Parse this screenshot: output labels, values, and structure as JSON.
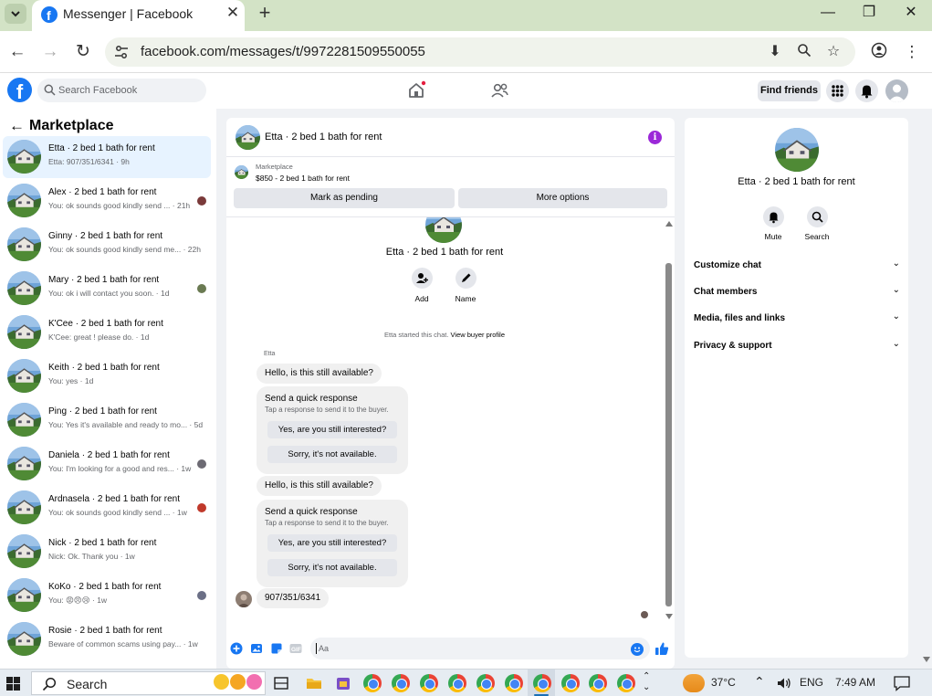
{
  "browser": {
    "tab_title": "Messenger | Facebook",
    "url": "facebook.com/messages/t/9972281509550055"
  },
  "fb": {
    "search_placeholder": "Search Facebook",
    "find_friends": "Find friends",
    "brand_color": "#1877f2"
  },
  "marketplace": {
    "title": "Marketplace",
    "conversations": [
      {
        "name": "Etta · 2 bed 1 bath for rent",
        "snippet": "Etta: 907/351/6341 · 9h",
        "active": true
      },
      {
        "name": "Alex · 2 bed 1 bath for rent",
        "snippet": "You: ok sounds good kindly send ... · 21h"
      },
      {
        "name": "Ginny · 2 bed 1 bath for rent",
        "snippet": "You: ok sounds good kindly send me... · 22h"
      },
      {
        "name": "Mary · 2 bed 1 bath for rent",
        "snippet": "You: ok i will contact you soon. · 1d"
      },
      {
        "name": "K'Cee · 2 bed 1 bath for rent",
        "snippet": "K'Cee: great ! please do. · 1d"
      },
      {
        "name": "Keith · 2 bed 1 bath for rent",
        "snippet": "You: yes · 1d"
      },
      {
        "name": "Ping · 2 bed 1 bath for rent",
        "snippet": "You: Yes it's available and ready to mo... · 5d"
      },
      {
        "name": "Daniela · 2 bed 1 bath for rent",
        "snippet": "You: I'm looking for a good and res... · 1w"
      },
      {
        "name": "Ardnasela · 2 bed 1 bath for rent",
        "snippet": "You: ok sounds good kindly send ... · 1w"
      },
      {
        "name": "Nick · 2 bed 1 bath for rent",
        "snippet": "Nick: Ok. Thank you · 1w"
      },
      {
        "name": "KoKo · 2 bed 1 bath for rent",
        "snippet": "You: 😡😠😢 · 1w"
      },
      {
        "name": "Rosie · 2 bed 1 bath for rent",
        "snippet": "Beware of common scams using pay... · 1w"
      }
    ]
  },
  "chat": {
    "title": "Etta · 2 bed 1 bath for rent",
    "listing_label": "Marketplace",
    "listing_title": "$850 - 2 bed 1 bath for rent",
    "mark_pending": "Mark as pending",
    "more_options": "More options",
    "intro_name": "Etta · 2 bed 1 bath for rent",
    "add_label": "Add",
    "name_label": "Name",
    "started_text": "Etta started this chat.",
    "buyer_link": "View buyer profile",
    "sender": "Etta",
    "msg_available": "Hello, is this still available?",
    "qr_title": "Send a quick response",
    "qr_sub": "Tap a response to send it to the buyer.",
    "qr_yes": "Yes, are you still interested?",
    "qr_no": "Sorry, it's not available.",
    "reply": "907/351/6341",
    "composer_placeholder": "Aa"
  },
  "info_panel": {
    "name": "Etta · 2 bed 1 bath for rent",
    "mute": "Mute",
    "search": "Search",
    "sections": [
      "Customize chat",
      "Chat members",
      "Media, files and links",
      "Privacy & support"
    ]
  },
  "taskbar": {
    "search": "Search",
    "temperature": "37°C",
    "language": "ENG",
    "time": "7:49 AM"
  }
}
